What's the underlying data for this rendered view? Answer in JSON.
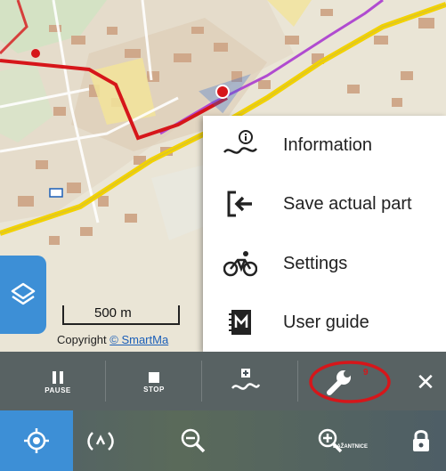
{
  "map": {
    "scale_label": "500 m",
    "copyright_prefix": "Copyright ",
    "copyright_link": "© SmartMa"
  },
  "menu": {
    "items": [
      {
        "label": "Information",
        "icon": "route-info-icon"
      },
      {
        "label": "Save actual part",
        "icon": "save-exit-icon"
      },
      {
        "label": "Settings",
        "icon": "bicycle-icon"
      },
      {
        "label": "User guide",
        "icon": "user-guide-book-icon"
      }
    ]
  },
  "track_panel": {
    "pause_label": "PAUSE",
    "stop_label": "STOP",
    "close_symbol": "✕"
  },
  "bottom_bar": {
    "map_label_fragment": "BAŽANTNICE"
  },
  "colors": {
    "accent_blue": "#3d8fd6",
    "highlight_red": "#d6161a",
    "panel_dark": "#45515a"
  }
}
